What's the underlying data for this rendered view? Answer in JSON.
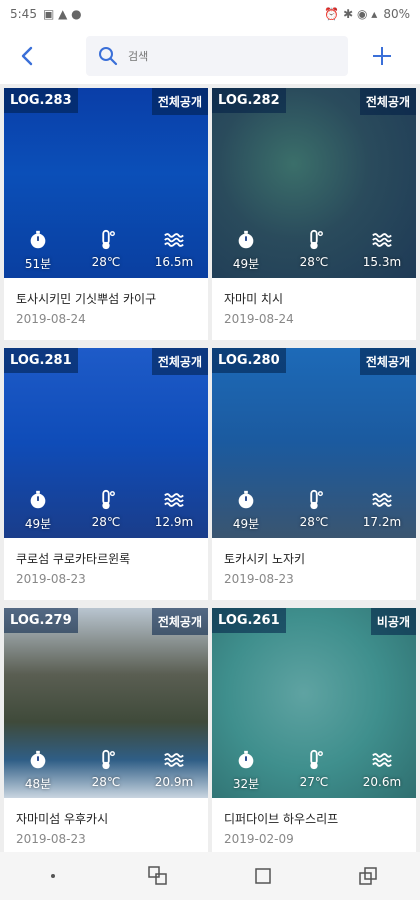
{
  "status": {
    "time": "5:45",
    "battery": "80%"
  },
  "search": {
    "placeholder": "검색"
  },
  "icons": {
    "back": "chevron-left-icon",
    "search": "search-icon",
    "add": "plus-icon",
    "timer": "stopwatch-icon",
    "temp": "thermometer-icon",
    "depth": "waves-icon"
  },
  "colors": {
    "accent": "#3a6fd8"
  },
  "logs": [
    {
      "log": "LOG.283",
      "visibility": "전체공개",
      "time": "51분",
      "temp": "28℃",
      "depth": "16.5m",
      "title": "토사시키민 기싯뿌섬 카이구",
      "date": "2019-08-24"
    },
    {
      "log": "LOG.282",
      "visibility": "전체공개",
      "time": "49분",
      "temp": "28℃",
      "depth": "15.3m",
      "title": "자마미 치시",
      "date": "2019-08-24"
    },
    {
      "log": "LOG.281",
      "visibility": "전체공개",
      "time": "49분",
      "temp": "28℃",
      "depth": "12.9m",
      "title": "쿠로섬 쿠로카타르윈록",
      "date": "2019-08-23"
    },
    {
      "log": "LOG.280",
      "visibility": "전체공개",
      "time": "49분",
      "temp": "28℃",
      "depth": "17.2m",
      "title": "토카시키 노자키",
      "date": "2019-08-23"
    },
    {
      "log": "LOG.279",
      "visibility": "전체공개",
      "time": "48분",
      "temp": "28℃",
      "depth": "20.9m",
      "title": "자마미섬 우후카시",
      "date": "2019-08-23"
    },
    {
      "log": "LOG.261",
      "visibility": "비공개",
      "time": "32분",
      "temp": "27℃",
      "depth": "20.6m",
      "title": "디퍼다이브 하우스리프",
      "date": "2019-02-09"
    }
  ]
}
